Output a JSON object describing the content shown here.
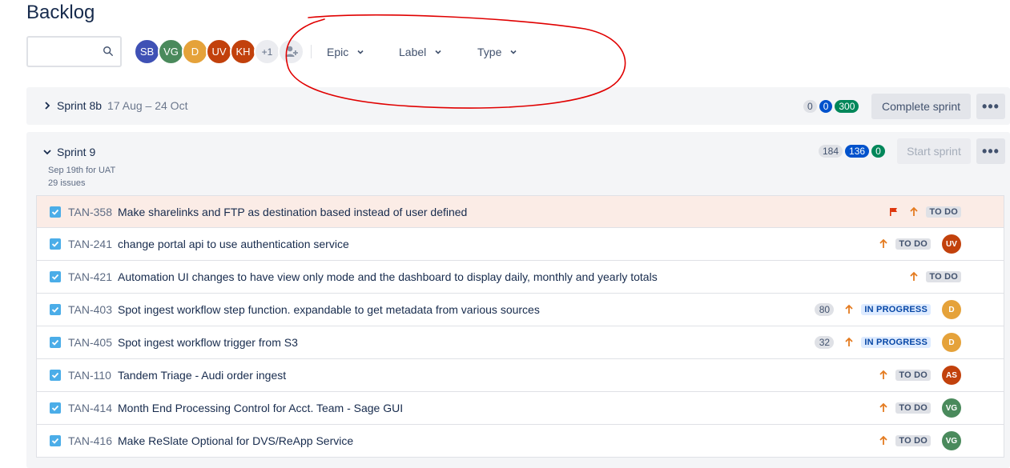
{
  "page": {
    "title": "Backlog"
  },
  "toolbar": {
    "search_placeholder": "",
    "avatars": [
      {
        "initials": "SB",
        "color": "#3f51b5"
      },
      {
        "initials": "VG",
        "color": "#4a8a5c"
      },
      {
        "initials": "D",
        "color": "#e5a23a"
      },
      {
        "initials": "UV",
        "color": "#c2410c"
      },
      {
        "initials": "KH",
        "color": "#c2410c"
      }
    ],
    "more_count": "+1",
    "filters": [
      "Epic",
      "Label",
      "Type"
    ]
  },
  "sprints": [
    {
      "name": "Sprint 8b",
      "dates": "17 Aug – 24 Oct",
      "counts": [
        "0",
        "0",
        "300"
      ],
      "action": "Complete sprint",
      "more": "•••"
    },
    {
      "name": "Sprint 9",
      "goal": "Sep 19th for UAT",
      "issue_count": "29 issues",
      "counts": [
        "184",
        "136",
        "0"
      ],
      "action": "Start sprint",
      "more": "•••"
    }
  ],
  "issues": [
    {
      "key": "TAN-358",
      "summary": "Make sharelinks and FTP as destination based instead of user defined",
      "status": "TO DO",
      "flagged": true
    },
    {
      "key": "TAN-241",
      "summary": "change portal api to use authentication service",
      "status": "TO DO",
      "assignee": "UV",
      "assignee_color": "#c2410c"
    },
    {
      "key": "TAN-421",
      "summary": "Automation UI changes to have view only mode and the dashboard to display daily, monthly and yearly totals",
      "status": "TO DO"
    },
    {
      "key": "TAN-403",
      "summary": "Spot ingest workflow step function. expandable to get metadata from various sources",
      "estimate": "80",
      "status": "IN PROGRESS",
      "assignee": "D",
      "assignee_color": "#e5a23a"
    },
    {
      "key": "TAN-405",
      "summary": "Spot ingest workflow trigger from S3",
      "estimate": "32",
      "status": "IN PROGRESS",
      "assignee": "D",
      "assignee_color": "#e5a23a"
    },
    {
      "key": "TAN-110",
      "summary": "Tandem Triage - Audi order ingest",
      "status": "TO DO",
      "assignee": "AS",
      "assignee_color": "#c2410c"
    },
    {
      "key": "TAN-414",
      "summary": "Month End Processing Control for Acct. Team - Sage GUI",
      "status": "TO DO",
      "assignee": "VG",
      "assignee_color": "#4a8a5c"
    },
    {
      "key": "TAN-416",
      "summary": "Make ReSlate Optional for DVS/ReApp Service",
      "status": "TO DO",
      "assignee": "VG",
      "assignee_color": "#4a8a5c"
    }
  ],
  "colors": {
    "priority_arrow": "#e47b20",
    "flag": "#de350b",
    "annotation": "#e00000",
    "checkbox": "#4bade8"
  }
}
